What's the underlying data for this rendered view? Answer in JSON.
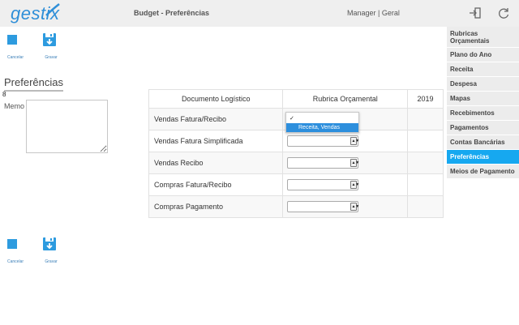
{
  "app": {
    "logo": "gestix",
    "title": "Budget - Preferências",
    "user": "Manager | Geral"
  },
  "colors": {
    "accent": "#16a8f0",
    "brand": "#2f8fd8"
  },
  "toolbar": {
    "cancel_label": "Cancelar",
    "save_label": "Gravar"
  },
  "section": {
    "title": "Preferências",
    "count": "8",
    "memo_label": "Memo",
    "memo_value": ""
  },
  "table": {
    "headers": [
      "Documento Logístico",
      "Rubrica Orçamental",
      "2019"
    ],
    "rows": [
      {
        "doc": "Vendas Fatura/Recibo",
        "rubrica": "",
        "year": ""
      },
      {
        "doc": "Vendas Fatura Simplificada",
        "rubrica": "",
        "year": ""
      },
      {
        "doc": "Vendas Recibo",
        "rubrica": "",
        "year": ""
      },
      {
        "doc": "Compras Fatura/Recibo",
        "rubrica": "",
        "year": ""
      },
      {
        "doc": "Compras Pagamento",
        "rubrica": "",
        "year": ""
      }
    ]
  },
  "dropdown": {
    "options": [
      "✓",
      "Receita, Vendas"
    ],
    "highlighted": "Receita, Vendas"
  },
  "sidebar": {
    "items": [
      {
        "label": "Rubricas Orçamentais"
      },
      {
        "label": "Plano do Ano"
      },
      {
        "label": "Receita"
      },
      {
        "label": "Despesa"
      },
      {
        "label": "Mapas"
      },
      {
        "label": "Recebimentos"
      },
      {
        "label": "Pagamentos"
      },
      {
        "label": "Contas Bancárias"
      },
      {
        "label": "Preferências"
      },
      {
        "label": "Meios de Pagamento"
      }
    ]
  }
}
